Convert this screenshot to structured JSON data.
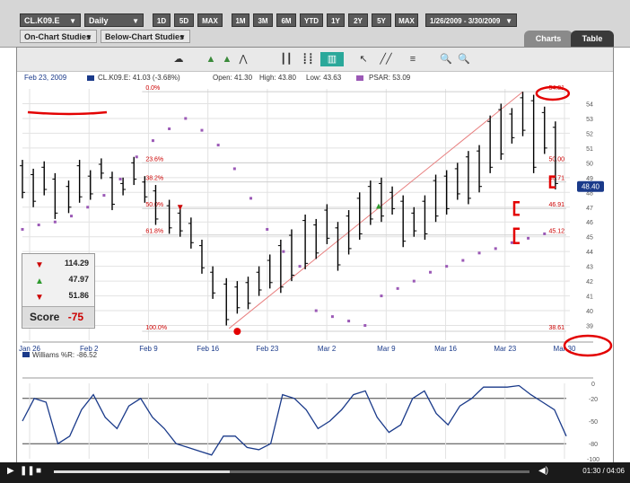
{
  "toolbar": {
    "symbol": "CL.K09.E",
    "period": "Daily",
    "ranges": [
      "1D",
      "5D",
      "MAX",
      "1M",
      "3M",
      "6M",
      "YTD",
      "1Y",
      "2Y",
      "5Y",
      "MAX"
    ],
    "date_range": "1/26/2009 - 3/30/2009",
    "on_chart": "On-Chart Studies",
    "below_chart": "Below-Chart Studies",
    "tab_charts": "Charts",
    "tab_table": "Table"
  },
  "info": {
    "date": "Feb 23, 2009",
    "symbol_value": "CL.K09.E: 41.03 (-3.68%)",
    "open": "Open: 41.30",
    "high": "High: 43.80",
    "low": "Low: 43.63",
    "psar": "PSAR: 53.09"
  },
  "chart_data": {
    "type": "line",
    "title": "",
    "x": [
      "Jan 26",
      "Feb 2",
      "Feb 9",
      "Feb 16",
      "Feb 23",
      "Mar 2",
      "Mar 9",
      "Mar 16",
      "Mar 23",
      "Mar 30"
    ],
    "y_ticks": [
      "54",
      "53",
      "52",
      "51",
      "50",
      "49",
      "48",
      "47",
      "46",
      "45",
      "44",
      "43",
      "42",
      "41",
      "40",
      "39"
    ],
    "ylim": [
      38,
      55
    ],
    "last_price_label": "48.40",
    "fib_levels": [
      {
        "label": "0.0%",
        "value": "54.81"
      },
      {
        "label": "23.6%",
        "value": "50.00"
      },
      {
        "label": "38.2%",
        "value": "48.71"
      },
      {
        "label": "50.0%",
        "value": "46.91"
      },
      {
        "label": "61.8%",
        "value": "45.12"
      },
      {
        "label": "100.0%",
        "value": "38.61"
      }
    ],
    "price_bars": [
      {
        "x": 0.0,
        "h": 50.2,
        "l": 47.6
      },
      {
        "x": 0.02,
        "h": 49.6,
        "l": 47.0
      },
      {
        "x": 0.04,
        "h": 50.1,
        "l": 47.8
      },
      {
        "x": 0.06,
        "h": 49.3,
        "l": 46.2
      },
      {
        "x": 0.085,
        "h": 48.8,
        "l": 46.6
      },
      {
        "x": 0.105,
        "h": 50.2,
        "l": 47.3
      },
      {
        "x": 0.125,
        "h": 49.5,
        "l": 47.5
      },
      {
        "x": 0.145,
        "h": 50.3,
        "l": 48.9
      },
      {
        "x": 0.165,
        "h": 49.4,
        "l": 46.8
      },
      {
        "x": 0.185,
        "h": 49.0,
        "l": 47.8
      },
      {
        "x": 0.205,
        "h": 50.4,
        "l": 48.5
      },
      {
        "x": 0.225,
        "h": 49.1,
        "l": 47.3
      },
      {
        "x": 0.245,
        "h": 48.5,
        "l": 45.8
      },
      {
        "x": 0.27,
        "h": 47.5,
        "l": 45.2
      },
      {
        "x": 0.29,
        "h": 47.0,
        "l": 45.0
      },
      {
        "x": 0.31,
        "h": 46.3,
        "l": 44.2
      },
      {
        "x": 0.33,
        "h": 44.8,
        "l": 42.5
      },
      {
        "x": 0.35,
        "h": 43.0,
        "l": 40.8
      },
      {
        "x": 0.375,
        "h": 42.2,
        "l": 39.0
      },
      {
        "x": 0.395,
        "h": 42.0,
        "l": 39.8
      },
      {
        "x": 0.415,
        "h": 42.3,
        "l": 40.1
      },
      {
        "x": 0.435,
        "h": 43.0,
        "l": 41.0
      },
      {
        "x": 0.455,
        "h": 43.8,
        "l": 41.5
      },
      {
        "x": 0.475,
        "h": 44.8,
        "l": 41.2
      },
      {
        "x": 0.495,
        "h": 45.5,
        "l": 42.0
      },
      {
        "x": 0.52,
        "h": 46.5,
        "l": 42.8
      },
      {
        "x": 0.54,
        "h": 46.2,
        "l": 43.5
      },
      {
        "x": 0.56,
        "h": 47.2,
        "l": 44.5
      },
      {
        "x": 0.58,
        "h": 46.0,
        "l": 42.7
      },
      {
        "x": 0.6,
        "h": 46.8,
        "l": 43.8
      },
      {
        "x": 0.62,
        "h": 48.0,
        "l": 44.8
      },
      {
        "x": 0.64,
        "h": 48.8,
        "l": 45.8
      },
      {
        "x": 0.66,
        "h": 49.0,
        "l": 46.0
      },
      {
        "x": 0.68,
        "h": 48.4,
        "l": 46.5
      },
      {
        "x": 0.7,
        "h": 47.8,
        "l": 44.3
      },
      {
        "x": 0.72,
        "h": 47.0,
        "l": 45.0
      },
      {
        "x": 0.74,
        "h": 47.8,
        "l": 44.8
      },
      {
        "x": 0.76,
        "h": 49.2,
        "l": 46.0
      },
      {
        "x": 0.78,
        "h": 49.5,
        "l": 46.5
      },
      {
        "x": 0.8,
        "h": 50.0,
        "l": 47.5
      },
      {
        "x": 0.82,
        "h": 50.8,
        "l": 47.2
      },
      {
        "x": 0.84,
        "h": 51.2,
        "l": 48.0
      },
      {
        "x": 0.86,
        "h": 53.2,
        "l": 49.3
      },
      {
        "x": 0.88,
        "h": 54.0,
        "l": 50.2
      },
      {
        "x": 0.9,
        "h": 53.7,
        "l": 51.3
      },
      {
        "x": 0.92,
        "h": 54.8,
        "l": 51.8
      },
      {
        "x": 0.94,
        "h": 54.6,
        "l": 49.3
      },
      {
        "x": 0.96,
        "h": 53.8,
        "l": 50.6
      },
      {
        "x": 0.98,
        "h": 52.8,
        "l": 48.2
      }
    ],
    "psar_dots": [
      {
        "x": 0.0,
        "v": 45.5
      },
      {
        "x": 0.03,
        "v": 45.8
      },
      {
        "x": 0.06,
        "v": 46.0
      },
      {
        "x": 0.09,
        "v": 46.4
      },
      {
        "x": 0.12,
        "v": 47.0
      },
      {
        "x": 0.15,
        "v": 47.8
      },
      {
        "x": 0.18,
        "v": 48.9
      },
      {
        "x": 0.21,
        "v": 50.4
      },
      {
        "x": 0.24,
        "v": 51.5
      },
      {
        "x": 0.27,
        "v": 52.3
      },
      {
        "x": 0.3,
        "v": 53.0
      },
      {
        "x": 0.33,
        "v": 52.2
      },
      {
        "x": 0.36,
        "v": 51.2
      },
      {
        "x": 0.39,
        "v": 49.6
      },
      {
        "x": 0.42,
        "v": 47.6
      },
      {
        "x": 0.45,
        "v": 45.5
      },
      {
        "x": 0.48,
        "v": 44.0
      },
      {
        "x": 0.51,
        "v": 43.0
      },
      {
        "x": 0.54,
        "v": 40.0
      },
      {
        "x": 0.57,
        "v": 39.6
      },
      {
        "x": 0.6,
        "v": 39.3
      },
      {
        "x": 0.63,
        "v": 39.0
      },
      {
        "x": 0.66,
        "v": 41.0
      },
      {
        "x": 0.69,
        "v": 41.5
      },
      {
        "x": 0.72,
        "v": 42.0
      },
      {
        "x": 0.75,
        "v": 42.6
      },
      {
        "x": 0.78,
        "v": 43.0
      },
      {
        "x": 0.81,
        "v": 43.4
      },
      {
        "x": 0.84,
        "v": 43.9
      },
      {
        "x": 0.87,
        "v": 44.2
      },
      {
        "x": 0.9,
        "v": 44.6
      },
      {
        "x": 0.93,
        "v": 44.9
      },
      {
        "x": 0.96,
        "v": 45.2
      }
    ]
  },
  "legend": {
    "rows": [
      {
        "icon": "buy-signal-icon",
        "value": "114.29"
      },
      {
        "icon": "up-triangle-icon",
        "value": "47.97"
      },
      {
        "icon": "down-triangle-icon",
        "value": "51.86"
      }
    ],
    "score_label": "Score",
    "score_value": "-75"
  },
  "williams": {
    "label": "Williams %R: -86.52",
    "y_ticks": [
      "0",
      "-20",
      "-50",
      "-80",
      "-100"
    ],
    "ylim": [
      -100,
      0
    ],
    "values": [
      -50,
      -20,
      -25,
      -80,
      -70,
      -35,
      -15,
      -45,
      -60,
      -30,
      -20,
      -45,
      -60,
      -80,
      -85,
      -90,
      -95,
      -70,
      -70,
      -85,
      -88,
      -80,
      -15,
      -20,
      -35,
      -60,
      -50,
      -35,
      -15,
      -10,
      -45,
      -65,
      -55,
      -20,
      -10,
      -40,
      -55,
      -30,
      -20,
      -5,
      -5,
      -5,
      -3,
      -15,
      -25,
      -35,
      -70
    ]
  },
  "player": {
    "time": "01:30 / 04:06",
    "progress": 0.37
  },
  "colors": {
    "bar": "#000000",
    "psar": "#9b59b6",
    "trend": "#e88080",
    "fib": "#cc0000",
    "annotation": "#e30000"
  }
}
